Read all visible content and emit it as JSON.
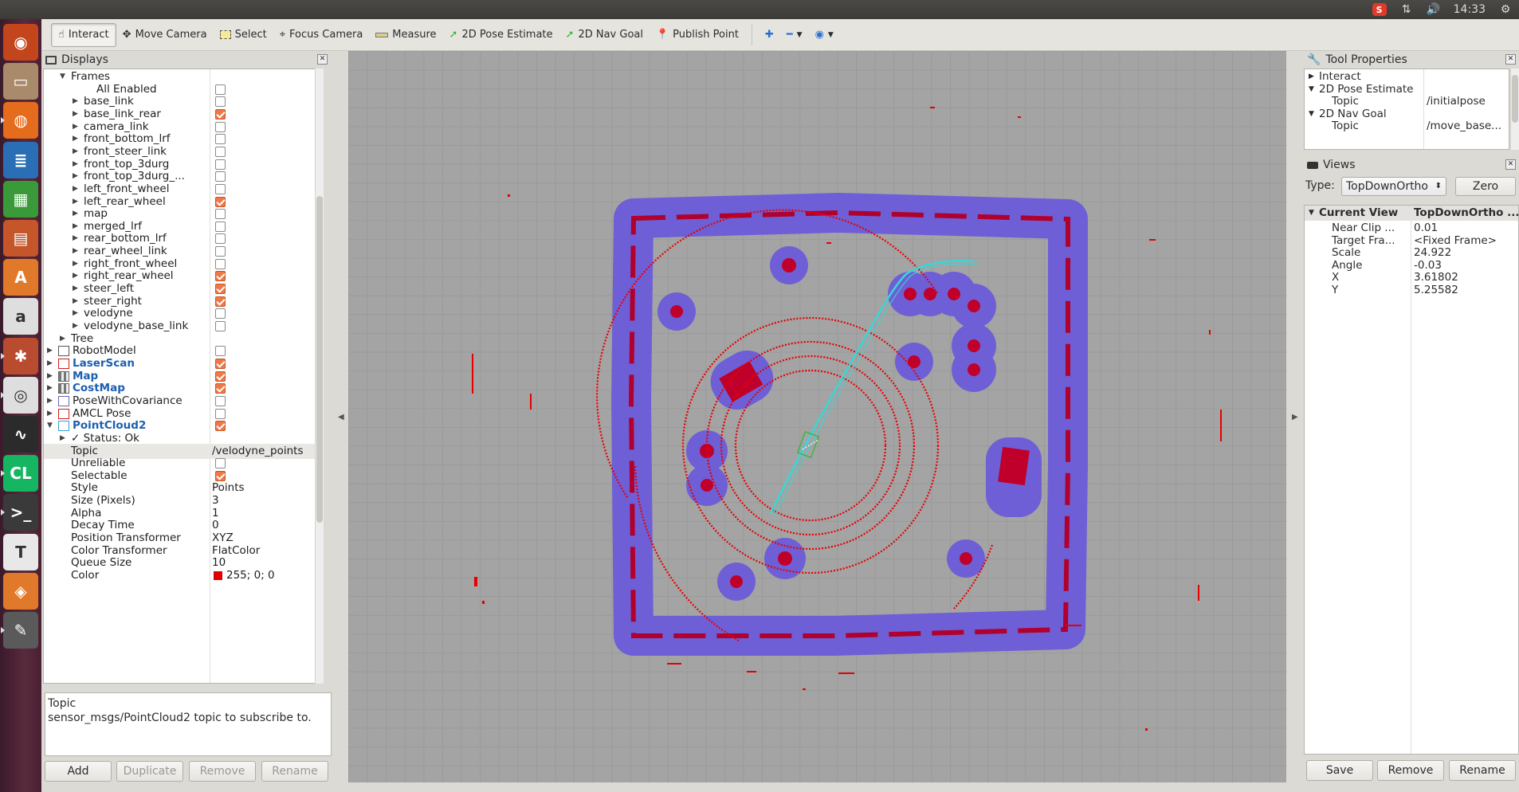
{
  "topbar": {
    "time": "14:33"
  },
  "launcher": {
    "items": [
      {
        "name": "ubuntu-dash-icon",
        "bg": "#c3451c",
        "glyph": "◉"
      },
      {
        "name": "files-icon",
        "bg": "#a98a6a",
        "glyph": "▭"
      },
      {
        "name": "firefox-icon",
        "bg": "#e46c1c",
        "glyph": "◍"
      },
      {
        "name": "writer-icon",
        "bg": "#2a6fb5",
        "glyph": "≣"
      },
      {
        "name": "calc-icon",
        "bg": "#3a9a3a",
        "glyph": "▦"
      },
      {
        "name": "impress-icon",
        "bg": "#c4562a",
        "glyph": "▤"
      },
      {
        "name": "software-center-icon",
        "bg": "#e07a2a",
        "glyph": "A"
      },
      {
        "name": "amazon-icon",
        "bg": "#dedede",
        "glyph": "a"
      },
      {
        "name": "settings-icon",
        "bg": "#b94b2f",
        "glyph": "✱"
      },
      {
        "name": "chrome-icon",
        "bg": "#dedede",
        "glyph": "◎"
      },
      {
        "name": "system-monitor-icon",
        "bg": "#2b2b2b",
        "glyph": "∿"
      },
      {
        "name": "clion-icon",
        "bg": "#15b562",
        "glyph": "CL"
      },
      {
        "name": "terminal-icon",
        "bg": "#3a3a3a",
        "glyph": ">_"
      },
      {
        "name": "text-editor-icon",
        "bg": "#e8e8e8",
        "glyph": "T"
      },
      {
        "name": "box-icon",
        "bg": "#e07a2a",
        "glyph": "◈"
      },
      {
        "name": "rviz-icon",
        "bg": "#5a5a5a",
        "glyph": "✎"
      }
    ]
  },
  "toolbar": {
    "interact": "Interact",
    "move_camera": "Move Camera",
    "select": "Select",
    "focus_camera": "Focus Camera",
    "measure": "Measure",
    "pose_estimate": "2D Pose Estimate",
    "nav_goal": "2D Nav Goal",
    "publish_point": "Publish Point"
  },
  "displays": {
    "title": "Displays",
    "rows": [
      {
        "indent": 1,
        "arrow": "▼",
        "name": "Frames",
        "cb": null
      },
      {
        "indent": 3,
        "arrow": "",
        "name": "All Enabled",
        "cb": false
      },
      {
        "indent": 2,
        "arrow": "▶",
        "name": "base_link",
        "cb": false
      },
      {
        "indent": 2,
        "arrow": "▶",
        "name": "base_link_rear",
        "cb": true
      },
      {
        "indent": 2,
        "arrow": "▶",
        "name": "camera_link",
        "cb": false
      },
      {
        "indent": 2,
        "arrow": "▶",
        "name": "front_bottom_lrf",
        "cb": false
      },
      {
        "indent": 2,
        "arrow": "▶",
        "name": "front_steer_link",
        "cb": false
      },
      {
        "indent": 2,
        "arrow": "▶",
        "name": "front_top_3durg",
        "cb": false
      },
      {
        "indent": 2,
        "arrow": "▶",
        "name": "front_top_3durg_...",
        "cb": false
      },
      {
        "indent": 2,
        "arrow": "▶",
        "name": "left_front_wheel",
        "cb": false
      },
      {
        "indent": 2,
        "arrow": "▶",
        "name": "left_rear_wheel",
        "cb": true
      },
      {
        "indent": 2,
        "arrow": "▶",
        "name": "map",
        "cb": false
      },
      {
        "indent": 2,
        "arrow": "▶",
        "name": "merged_lrf",
        "cb": false
      },
      {
        "indent": 2,
        "arrow": "▶",
        "name": "rear_bottom_lrf",
        "cb": false
      },
      {
        "indent": 2,
        "arrow": "▶",
        "name": "rear_wheel_link",
        "cb": false
      },
      {
        "indent": 2,
        "arrow": "▶",
        "name": "right_front_wheel",
        "cb": false
      },
      {
        "indent": 2,
        "arrow": "▶",
        "name": "right_rear_wheel",
        "cb": true
      },
      {
        "indent": 2,
        "arrow": "▶",
        "name": "steer_left",
        "cb": true
      },
      {
        "indent": 2,
        "arrow": "▶",
        "name": "steer_right",
        "cb": true
      },
      {
        "indent": 2,
        "arrow": "▶",
        "name": "velodyne",
        "cb": false
      },
      {
        "indent": 2,
        "arrow": "▶",
        "name": "velodyne_base_link",
        "cb": false
      },
      {
        "indent": 1,
        "arrow": "▶",
        "name": "Tree",
        "cb": null
      },
      {
        "indent": 0,
        "arrow": "▶",
        "name": "RobotModel",
        "cb": false,
        "icon": "robot"
      },
      {
        "indent": 0,
        "arrow": "▶",
        "name": "LaserScan",
        "cb": true,
        "icon": "laser",
        "bold": true
      },
      {
        "indent": 0,
        "arrow": "▶",
        "name": "Map",
        "cb": true,
        "icon": "map",
        "bold": true
      },
      {
        "indent": 0,
        "arrow": "▶",
        "name": "CostMap",
        "cb": true,
        "icon": "map",
        "bold": true
      },
      {
        "indent": 0,
        "arrow": "▶",
        "name": "PoseWithCovariance",
        "cb": false,
        "icon": "pose"
      },
      {
        "indent": 0,
        "arrow": "▶",
        "name": "AMCL Pose",
        "cb": false,
        "icon": "amcl"
      },
      {
        "indent": 0,
        "arrow": "▼",
        "name": "PointCloud2",
        "cb": true,
        "icon": "cloud",
        "bold": true
      },
      {
        "indent": 1,
        "arrow": "▶",
        "name": "✓ Status: Ok",
        "cb": null
      },
      {
        "indent": 1,
        "arrow": "",
        "name": "Topic",
        "cb": null,
        "value": "/velodyne_points",
        "selected": true
      },
      {
        "indent": 1,
        "arrow": "",
        "name": "Unreliable",
        "cb": false
      },
      {
        "indent": 1,
        "arrow": "",
        "name": "Selectable",
        "cb": true
      },
      {
        "indent": 1,
        "arrow": "",
        "name": "Style",
        "cb": null,
        "value": "Points"
      },
      {
        "indent": 1,
        "arrow": "",
        "name": "Size (Pixels)",
        "cb": null,
        "value": "3"
      },
      {
        "indent": 1,
        "arrow": "",
        "name": "Alpha",
        "cb": null,
        "value": "1"
      },
      {
        "indent": 1,
        "arrow": "",
        "name": "Decay Time",
        "cb": null,
        "value": "0"
      },
      {
        "indent": 1,
        "arrow": "",
        "name": "Position Transformer",
        "cb": null,
        "value": "XYZ"
      },
      {
        "indent": 1,
        "arrow": "",
        "name": "Color Transformer",
        "cb": null,
        "value": "FlatColor"
      },
      {
        "indent": 1,
        "arrow": "",
        "name": "Queue Size",
        "cb": null,
        "value": "10"
      },
      {
        "indent": 1,
        "arrow": "",
        "name": "Color",
        "cb": null,
        "value": "255; 0; 0",
        "swatch": "#e00000"
      }
    ],
    "desc_title": "Topic",
    "desc_text": "sensor_msgs/PointCloud2 topic to subscribe to.",
    "buttons": {
      "add": "Add",
      "duplicate": "Duplicate",
      "remove": "Remove",
      "rename": "Rename"
    }
  },
  "tool_properties": {
    "title": "Tool Properties",
    "rows": [
      {
        "indent": 0,
        "arrow": "▶",
        "name": "Interact",
        "value": ""
      },
      {
        "indent": 0,
        "arrow": "▼",
        "name": "2D Pose Estimate",
        "value": ""
      },
      {
        "indent": 1,
        "arrow": "",
        "name": "Topic",
        "value": "/initialpose"
      },
      {
        "indent": 0,
        "arrow": "▼",
        "name": "2D Nav Goal",
        "value": ""
      },
      {
        "indent": 1,
        "arrow": "",
        "name": "Topic",
        "value": "/move_base..."
      }
    ]
  },
  "views": {
    "title": "Views",
    "type_label": "Type:",
    "type_value": "TopDownOrtho",
    "zero": "Zero",
    "header": {
      "name": "Current View",
      "value": "TopDownOrtho ..."
    },
    "rows": [
      {
        "name": "Near Clip ...",
        "value": "0.01"
      },
      {
        "name": "Target Fra...",
        "value": "<Fixed Frame>"
      },
      {
        "name": "Scale",
        "value": "24.922"
      },
      {
        "name": "Angle",
        "value": "-0.03"
      },
      {
        "name": "X",
        "value": "3.61802"
      },
      {
        "name": "Y",
        "value": "5.25582"
      }
    ],
    "buttons": {
      "save": "Save",
      "remove": "Remove",
      "rename": "Rename"
    }
  },
  "colors": {
    "costmap_inflation": "#6e5fd6",
    "costmap_lethal": "#c0002a",
    "laser": "#e60000",
    "path": "#37d7d7"
  }
}
